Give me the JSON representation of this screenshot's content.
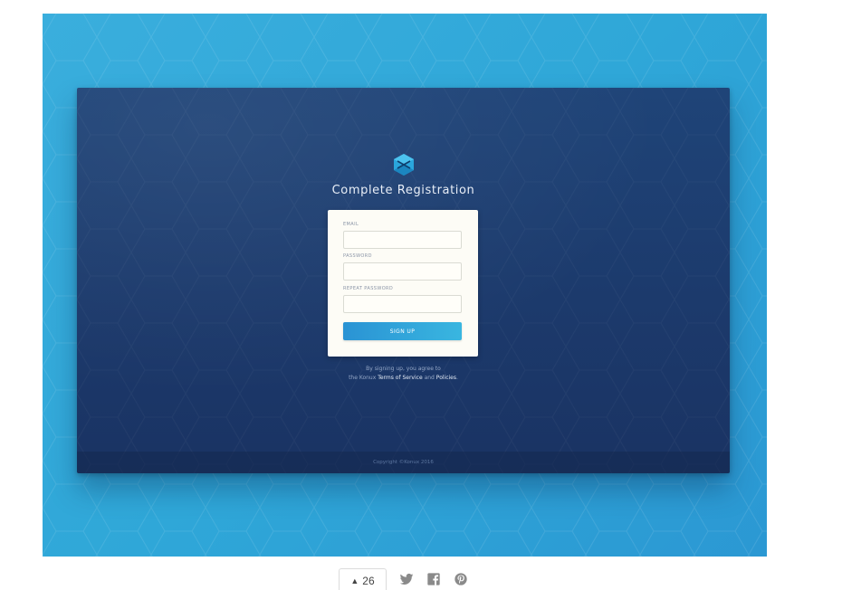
{
  "registration": {
    "heading": "Complete Registration",
    "email_label": "EMAIL",
    "password_label": "PASSWORD",
    "repeat_password_label": "REPEAT PASSWORD",
    "signup_label": "SIGN UP",
    "terms_line1": "By signing up, you agree to",
    "terms_prefix": "the Konux",
    "terms_link": "Terms of Service",
    "terms_and": "and",
    "policies_link": "Policies",
    "terms_suffix": ".",
    "copyright": "Copyright ©Konux 2016"
  },
  "shot_actions": {
    "like_count": "26",
    "icons": [
      "triangle-up-icon",
      "twitter-icon",
      "facebook-icon",
      "pinterest-icon"
    ]
  },
  "colors": {
    "background_blue": "#2fa7d8",
    "window_navy": "#1c3a6c",
    "button_blue": "#2a93d4",
    "card_cream": "#fdfcf6"
  }
}
